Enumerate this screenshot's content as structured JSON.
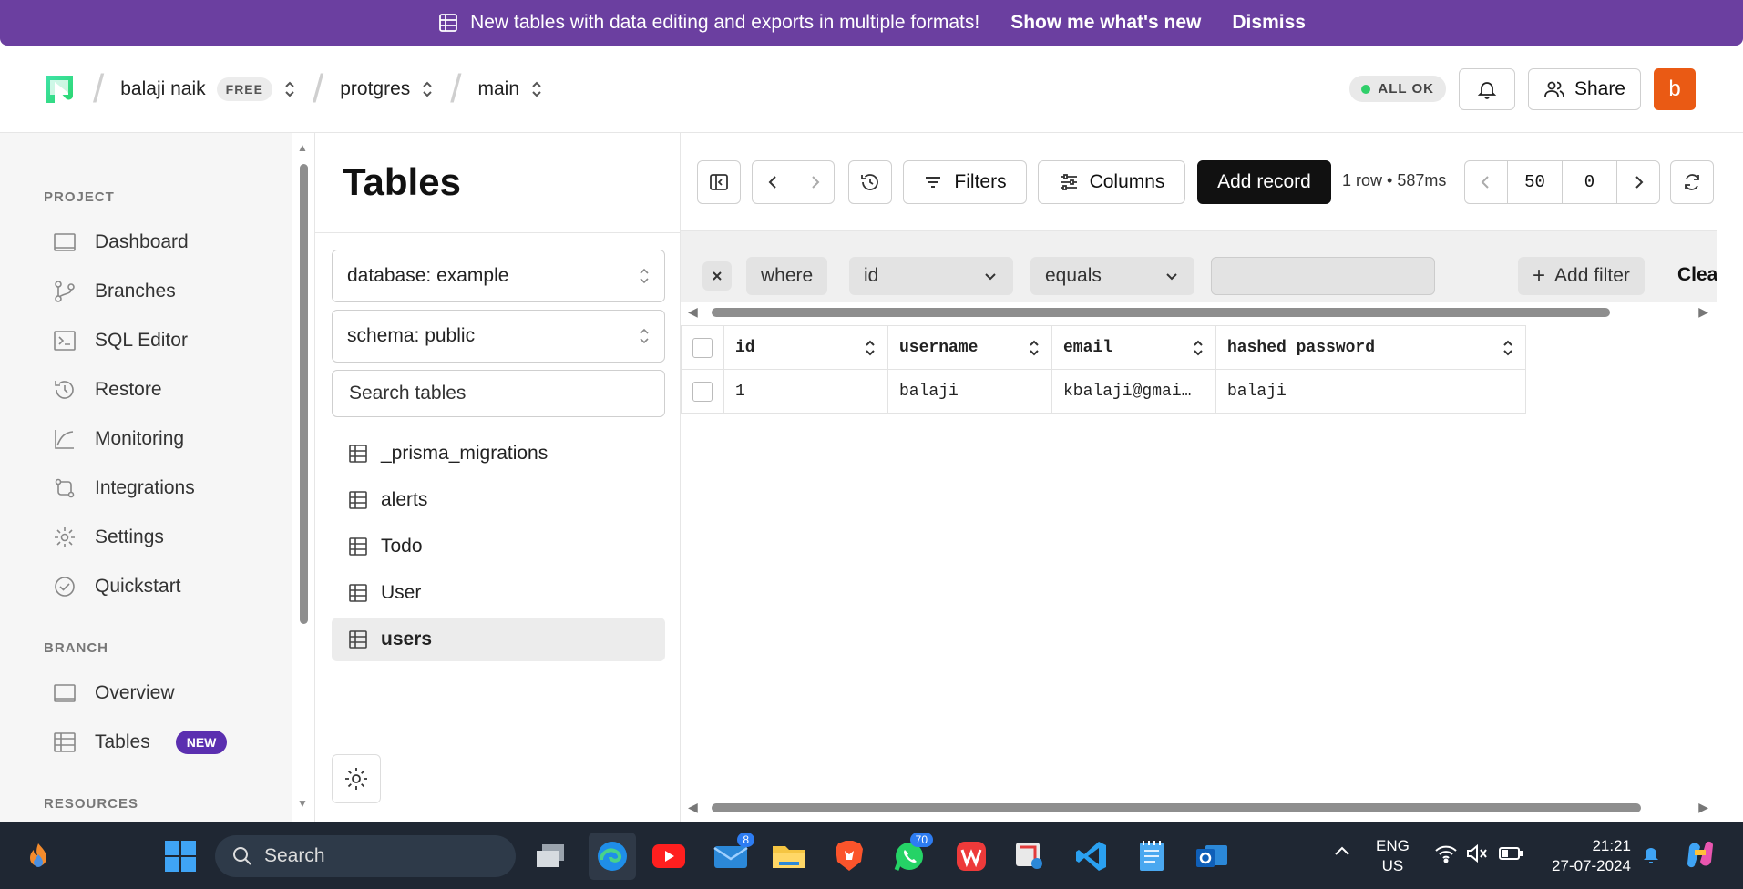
{
  "banner": {
    "message": "New tables with data editing and exports in multiple formats!",
    "show_new": "Show me what's new",
    "dismiss": "Dismiss"
  },
  "header": {
    "user": "balaji naik",
    "plan": "FREE",
    "project": "protgres",
    "branch": "main",
    "status": "ALL OK",
    "share": "Share",
    "avatar_letter": "b"
  },
  "sidebar": {
    "project_label": "PROJECT",
    "project_items": [
      {
        "label": "Dashboard",
        "icon": "dashboard-icon"
      },
      {
        "label": "Branches",
        "icon": "branches-icon"
      },
      {
        "label": "SQL Editor",
        "icon": "sql-editor-icon"
      },
      {
        "label": "Restore",
        "icon": "restore-icon"
      },
      {
        "label": "Monitoring",
        "icon": "monitoring-icon"
      },
      {
        "label": "Integrations",
        "icon": "integrations-icon"
      },
      {
        "label": "Settings",
        "icon": "settings-icon"
      },
      {
        "label": "Quickstart",
        "icon": "quickstart-icon"
      }
    ],
    "branch_label": "BRANCH",
    "branch_items": [
      {
        "label": "Overview",
        "icon": "overview-icon"
      },
      {
        "label": "Tables",
        "icon": "tables-icon",
        "badge": "NEW"
      }
    ],
    "resources_label": "RESOURCES"
  },
  "tables_panel": {
    "title": "Tables",
    "database": "database: example",
    "schema": "schema: public",
    "search_placeholder": "Search tables",
    "tables": [
      "_prisma_migrations",
      "alerts",
      "Todo",
      "User",
      "users"
    ],
    "selected": "users"
  },
  "toolbar": {
    "filters": "Filters",
    "columns": "Columns",
    "add_record": "Add record",
    "row_info": "1 row • 587ms",
    "limit": "50",
    "offset": "0"
  },
  "filter": {
    "where": "where",
    "column": "id",
    "operator": "equals",
    "value": "",
    "add_filter": "Add filter",
    "clear": "Clea"
  },
  "grid": {
    "columns": [
      "id",
      "username",
      "email",
      "hashed_password"
    ],
    "rows": [
      [
        "1",
        "balaji",
        "kbalaji@gmai…",
        "balaji"
      ]
    ]
  },
  "taskbar": {
    "search": "Search",
    "mail_count": "8",
    "whatsapp_count": "70",
    "language": "ENG",
    "region": "US",
    "time": "21:21",
    "date": "27-07-2024"
  },
  "colors": {
    "banner": "#6b3fa0",
    "avatar": "#ea5a14",
    "status_dot": "#2fcf6a",
    "new_badge": "#5b2fb0"
  }
}
